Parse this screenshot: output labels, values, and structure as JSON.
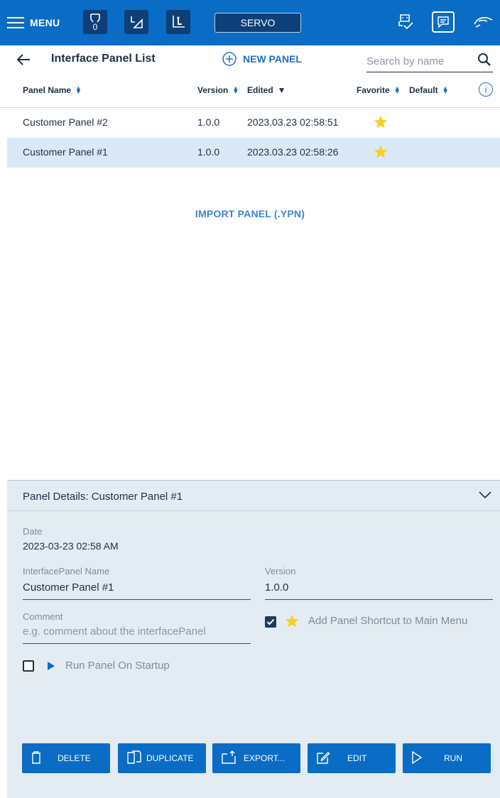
{
  "topbar": {
    "menu_label": "MENU",
    "gripper_count": "0",
    "servo_label": "SERVO",
    "icons": [
      "hamburger-icon",
      "gripper-icon",
      "jog-plane-icon",
      "coordinate-frame-icon",
      "robot-arm-icon",
      "chat-icon",
      "hand-guide-icon"
    ]
  },
  "header": {
    "title": "Interface Panel List",
    "new_panel_label": "NEW PANEL",
    "search_placeholder": "Search by name"
  },
  "table": {
    "columns": {
      "name": "Panel Name",
      "version": "Version",
      "edited": "Edited",
      "favorite": "Favorite",
      "default": "Default"
    },
    "rows": [
      {
        "name": "Customer Panel #2",
        "version": "1.0.0",
        "edited": "2023.03.23 02:58:51",
        "favorite": true
      },
      {
        "name": "Customer Panel #1",
        "version": "1.0.0",
        "edited": "2023.03.23 02:58:26",
        "favorite": true
      }
    ],
    "selected_row": 1
  },
  "import_label": "IMPORT PANEL (.YPN)",
  "details": {
    "title": "Panel Details: Customer Panel #1",
    "date_label": "Date",
    "date_value": "2023-03-23 02:58 AM",
    "name_label": "InterfacePanel Name",
    "name_value": "Customer Panel #1",
    "version_label": "Version",
    "version_value": "1.0.0",
    "comment_label": "Comment",
    "comment_placeholder": "e.g. comment about the interfacePanel",
    "shortcut_label": "Add Panel Shortcut to Main Menu",
    "shortcut_checked": true,
    "startup_label": "Run Panel On Startup",
    "startup_checked": false
  },
  "actions": {
    "delete": "DELETE",
    "duplicate": "DUPLICATE",
    "export": "EXPORT...",
    "edit": "EDIT",
    "run": "RUN"
  },
  "colors": {
    "primary": "#0a6cc4",
    "dark_square": "#0d3f78",
    "selected_row": "#dbe9f7",
    "panel_bg": "#e3ecf2",
    "star": "#f5d020",
    "link": "#3a86d4"
  }
}
